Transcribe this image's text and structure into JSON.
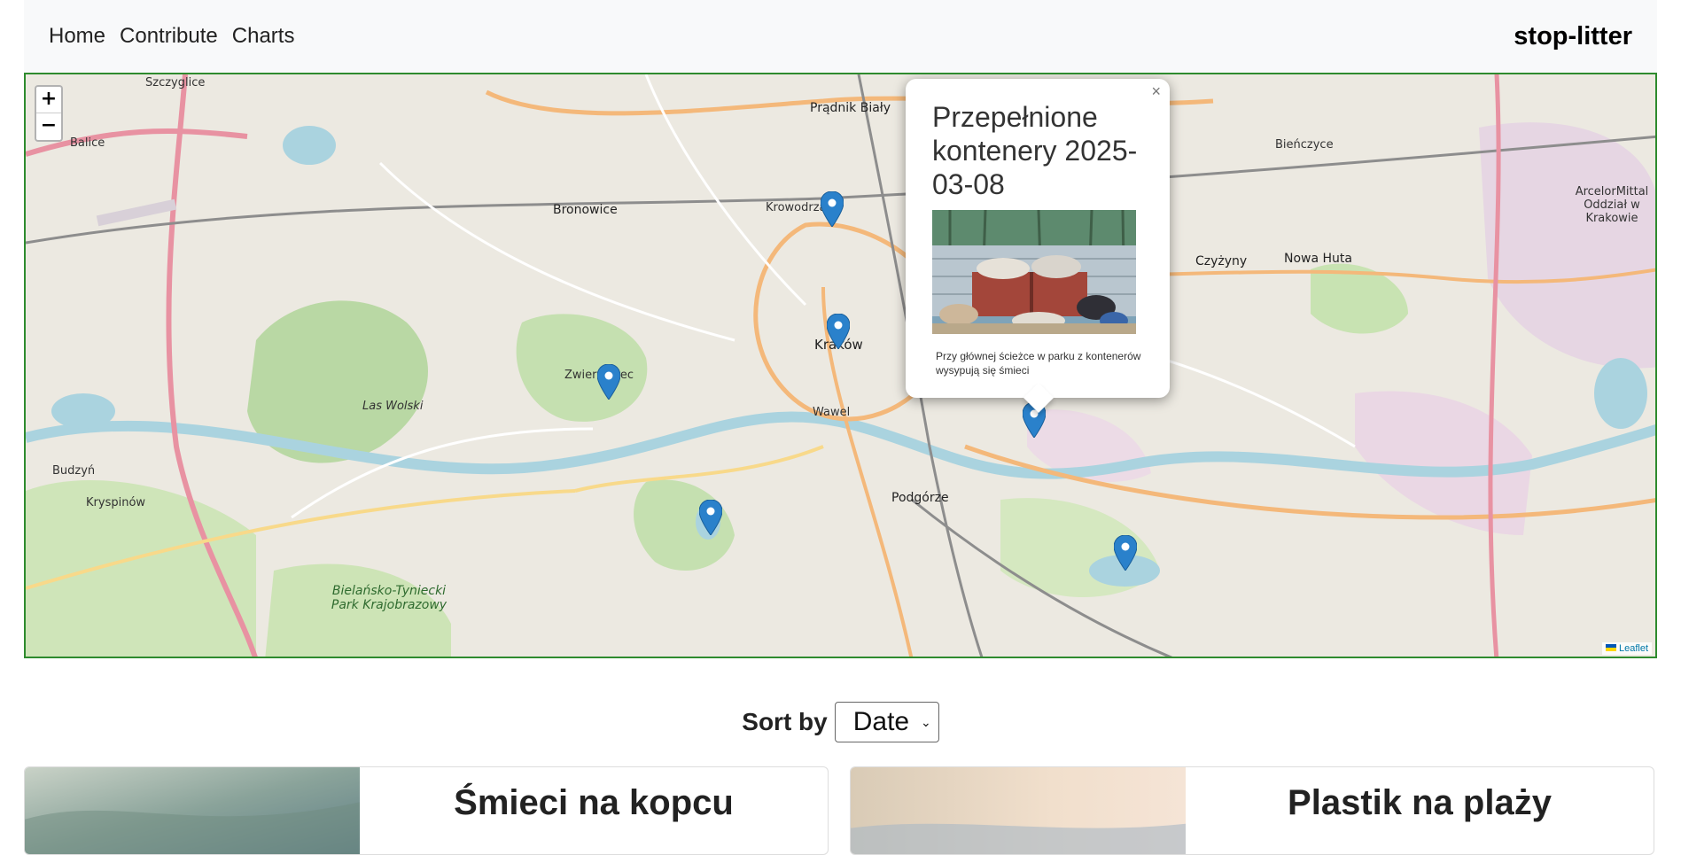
{
  "nav": {
    "links": [
      "Home",
      "Contribute",
      "Charts"
    ],
    "brand": "stop-litter"
  },
  "map": {
    "zoom_in": "+",
    "zoom_out": "−",
    "attribution": "Leaflet",
    "labels": {
      "krakow": "Kraków",
      "bronowice": "Bronowice",
      "krowodrza": "Krowodrza",
      "nowa_huta": "Nowa Huta",
      "czyzyny": "Czyżyny",
      "podgorze": "Podgórze",
      "zwierzyniec": "Zwierzyniec",
      "bienczyce": "Bieńczyce",
      "pradnik_bialy": "Prądnik Biały",
      "balice": "Balice",
      "budzyn": "Budzyń",
      "kryspinow": "Kryspinów",
      "las_wolski": "Las Wolski",
      "park_bielansko": "Bielańsko-Tyniecki Park Krajobrazowy",
      "wawel": "Wawel",
      "arcelor": "ArcelorMittal Oddział w Krakowie",
      "szczyglice": "Szczyglice"
    },
    "popup": {
      "close": "×",
      "title": "Przepełnione kontenery 2025-03-08",
      "description": "Przy głównej ścieżce w parku z kontenerów wysypują się śmieci"
    }
  },
  "sort": {
    "label": "Sort by",
    "selected": "Date"
  },
  "cards": [
    {
      "title": "Śmieci na kopcu"
    },
    {
      "title": "Plastik na plaży"
    }
  ]
}
